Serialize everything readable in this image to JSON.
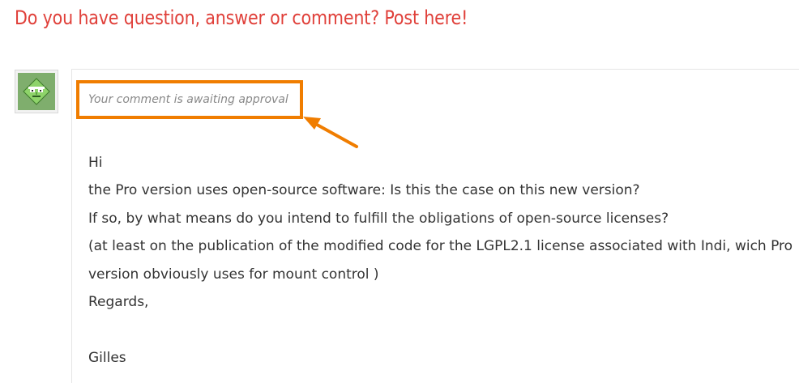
{
  "heading": "Do you have question, answer or comment? Post here!",
  "comment": {
    "avatar_icon": "green-face-avatar-icon",
    "moderation_notice": "Your comment is awaiting approval",
    "lines": [
      "Hi",
      "the Pro version uses open-source software: Is this the case on this new version?",
      "If so, by what means do you intend to fulfill the obligations of open-source licenses?",
      "(at least on the publication of the modified code for the LGPL2.1 license associated with Indi, wich Pro",
      "version obviously uses for mount control )",
      "Regards,"
    ],
    "signature": "Gilles"
  },
  "annotation": {
    "highlight_color": "#f07d00",
    "arrow_icon": "arrow-pointer-icon"
  },
  "colors": {
    "heading": "#e0403a",
    "notice": "#888888",
    "body_text": "#333333"
  }
}
